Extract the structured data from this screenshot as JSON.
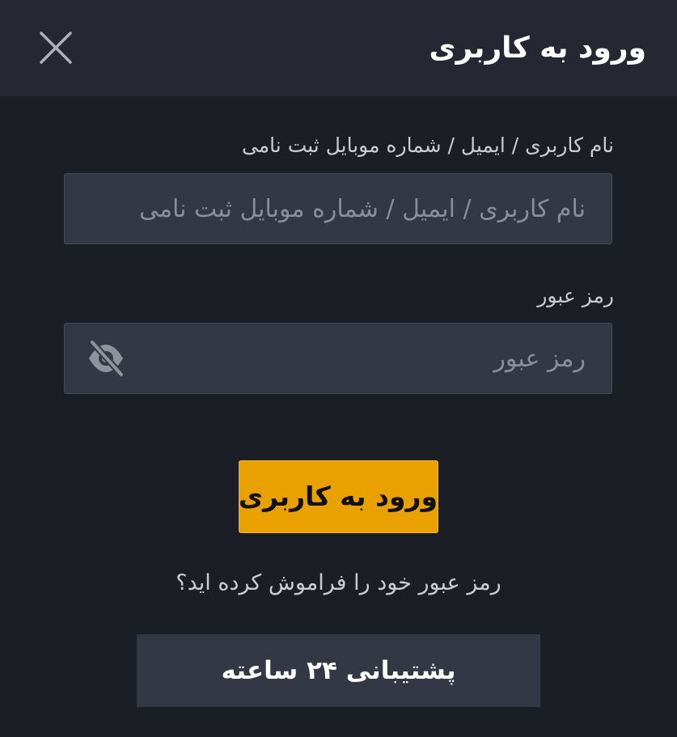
{
  "header": {
    "title": "ورود به کاربری",
    "close_icon": "close-icon"
  },
  "form": {
    "username": {
      "label": "نام کاربری / ایمیل / شماره موبایل ثبت نامی",
      "placeholder": "نام کاربری / ایمیل / شماره موبایل ثبت نامی",
      "value": ""
    },
    "password": {
      "label": "رمز عبور",
      "placeholder": "رمز عبور",
      "value": "",
      "toggle_icon": "eye-slash-icon"
    },
    "login_button": "ورود به کاربری",
    "forgot_password": "رمز عبور خود را فراموش کرده اید؟",
    "support_button": "پشتیبانی ۲۴ ساعته"
  },
  "colors": {
    "background": "#1c1e26",
    "header": "#252833",
    "input": "#343844",
    "accent": "#e8a100"
  }
}
